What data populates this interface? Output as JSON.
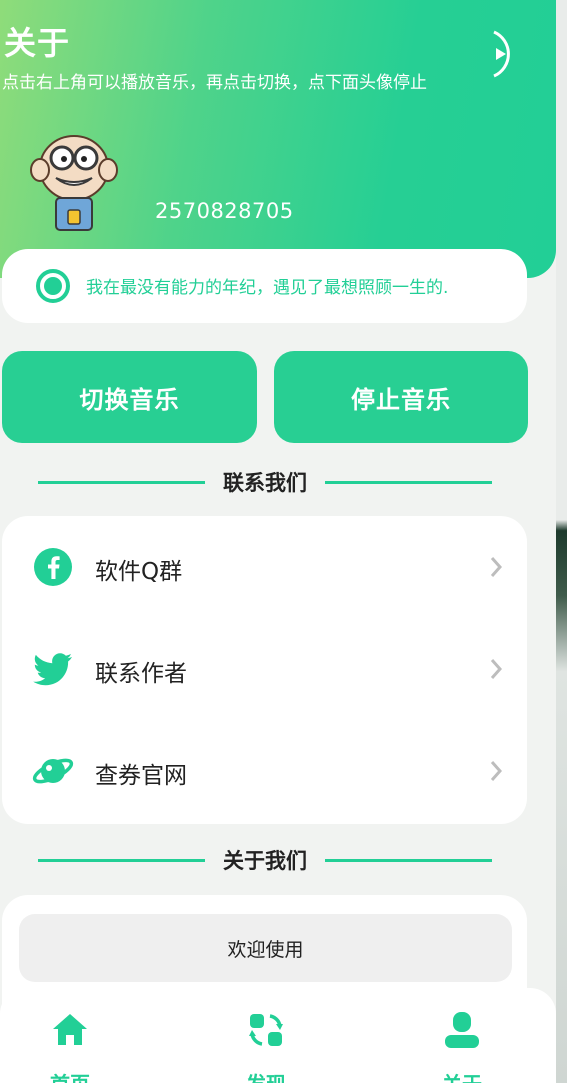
{
  "header": {
    "title": "关于",
    "subtitle": "点击右上角可以播放音乐，再点击切换，点下面头像停止",
    "qq_number": "2570828705"
  },
  "quote": {
    "text": "我在最没有能力的年纪，遇见了最想照顾一生的."
  },
  "music_buttons": {
    "switch_label": "切换音乐",
    "stop_label": "停止音乐"
  },
  "contact_section": {
    "title": "联系我们",
    "items": [
      {
        "label": "软件Q群",
        "icon": "facebook-icon"
      },
      {
        "label": "联系作者",
        "icon": "twitter-icon"
      },
      {
        "label": "查券官网",
        "icon": "planet-icon"
      }
    ]
  },
  "about_section": {
    "title": "关于我们",
    "welcome": "欢迎使用"
  },
  "tabbar": {
    "tabs": [
      {
        "label": "首页",
        "icon": "home-icon"
      },
      {
        "label": "发现",
        "icon": "discover-icon"
      },
      {
        "label": "关于",
        "icon": "user-icon",
        "active": true
      }
    ]
  },
  "colors": {
    "accent": "#22cf96",
    "gradient_start": "#8fdc7a",
    "background": "#f1f3f1"
  }
}
